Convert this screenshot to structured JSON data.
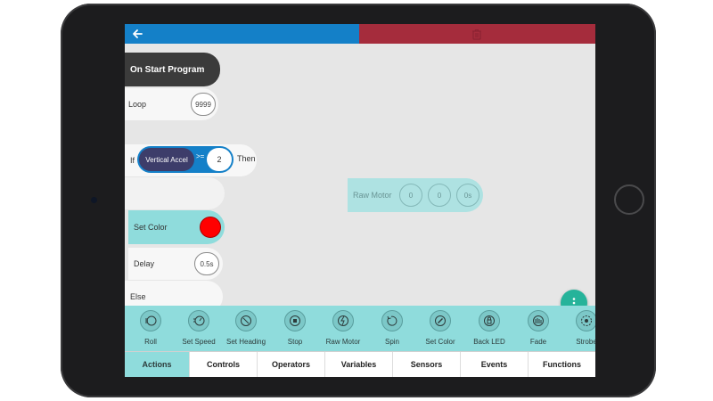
{
  "colors": {
    "header_left": "#1480c8",
    "header_right": "#a52c3c",
    "palette_bg": "#8fdcdc",
    "fab": "#26b39a",
    "set_color_value": "#ff0000"
  },
  "header": {
    "back_icon": "arrow-left-icon",
    "delete_icon": "trash-icon"
  },
  "program": {
    "start_label": "On Start Program",
    "loop_label": "Loop",
    "loop_count": "9999",
    "if_label": "If",
    "if_sensor": "Vertical Accel",
    "if_operator": ">=",
    "if_value": "2",
    "then_label": "Then",
    "set_color_label": "Set Color",
    "delay_label": "Delay",
    "delay_value": "0.5s",
    "else_label": "Else"
  },
  "floating_block": {
    "label": "Raw Motor",
    "left": "0",
    "right": "0",
    "duration": "0s"
  },
  "fab": {
    "icon": "more-vertical-icon"
  },
  "palette": {
    "items": [
      {
        "label": "Roll",
        "icon": "roll-icon"
      },
      {
        "label": "Set Speed",
        "icon": "speed-icon"
      },
      {
        "label": "Set Heading",
        "icon": "heading-icon"
      },
      {
        "label": "Stop",
        "icon": "stop-icon"
      },
      {
        "label": "Raw Motor",
        "icon": "raw-motor-icon"
      },
      {
        "label": "Spin",
        "icon": "spin-icon"
      },
      {
        "label": "Set Color",
        "icon": "color-picker-icon"
      },
      {
        "label": "Back LED",
        "icon": "back-led-icon"
      },
      {
        "label": "Fade",
        "icon": "fade-icon"
      },
      {
        "label": "Strobe",
        "icon": "strobe-icon"
      }
    ]
  },
  "tabs": [
    {
      "label": "Actions",
      "active": true
    },
    {
      "label": "Controls",
      "active": false
    },
    {
      "label": "Operators",
      "active": false
    },
    {
      "label": "Variables",
      "active": false
    },
    {
      "label": "Sensors",
      "active": false
    },
    {
      "label": "Events",
      "active": false
    },
    {
      "label": "Functions",
      "active": false
    }
  ]
}
